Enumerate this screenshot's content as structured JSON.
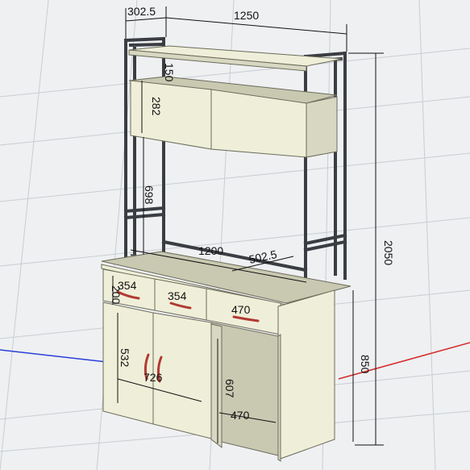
{
  "dimensions": {
    "top_depth": "302.5",
    "top_width": "1250",
    "total_height": "2050",
    "shelf_gap": "150",
    "cabinet_height": "282",
    "frame_open_height": "698",
    "desk_width": "1200",
    "desk_depth": "502.5",
    "drawer_1": "354",
    "drawer_2": "354",
    "drawer_3": "470",
    "drawer_height": "200",
    "door_height": "532",
    "door_width": "726",
    "knee_height": "607",
    "knee_width": "470",
    "desk_height": "850"
  },
  "colors": {
    "frame": "#3a3d42",
    "wood": "#efefd9",
    "handle": "#b23a33",
    "axis_x": "#d62a2a",
    "axis_y": "#2a3fd6"
  }
}
